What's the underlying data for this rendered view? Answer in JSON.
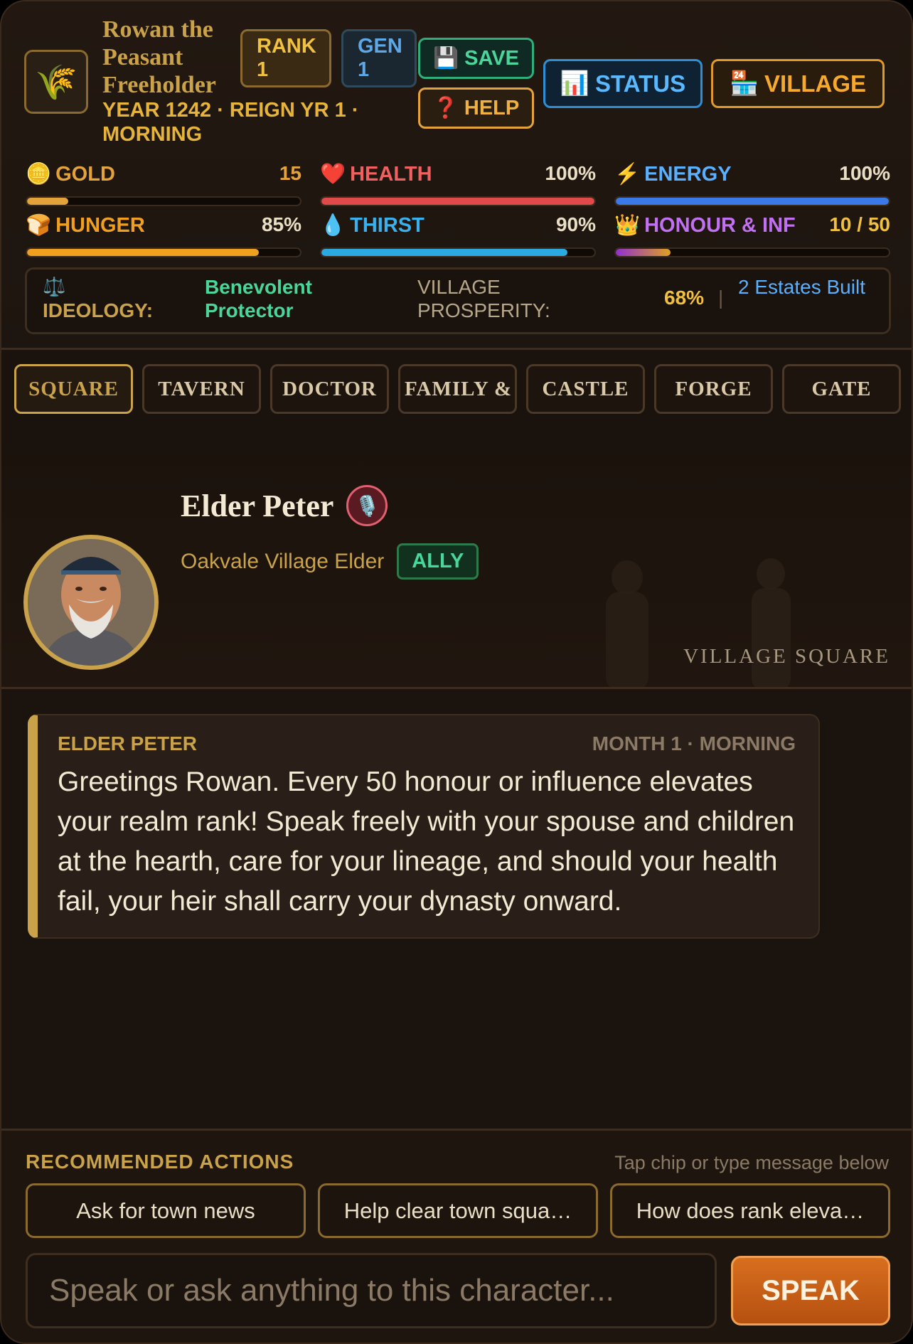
{
  "header": {
    "character_emblem": "wheat-icon",
    "character_name": "Rowan the Peasant Freeholder",
    "date_line": "YEAR 1242 · REIGN YR 1 · MORNING",
    "rank_label": "RANK",
    "rank_value": "1",
    "gen_label": "GEN",
    "gen_value": "1",
    "save_label": "SAVE",
    "help_label": "HELP",
    "status_label": "STATUS",
    "village_label": "VILLAGE"
  },
  "stats": {
    "gold": {
      "label": "GOLD",
      "value": "15",
      "fill": 0.15,
      "color": "#e3a23a"
    },
    "health": {
      "label": "HEALTH",
      "value": "100%",
      "fill": 1.0,
      "color": "#e04a4a"
    },
    "energy": {
      "label": "ENERGY",
      "value": "100%",
      "fill": 1.0,
      "color": "#3a7ae8"
    },
    "hunger": {
      "label": "HUNGER",
      "value": "85%",
      "fill": 0.85,
      "color": "#f0a020"
    },
    "thirst": {
      "label": "THIRST",
      "value": "90%",
      "fill": 0.9,
      "color": "#2aaae0"
    },
    "honour": {
      "label": "HONOUR & INF",
      "value": "10 / 50",
      "fill": 0.2,
      "color": "#b040e0"
    }
  },
  "ideology": {
    "label": "IDEOLOGY:",
    "value": "Benevolent Protector",
    "prosperity_label": "VILLAGE PROSPERITY:",
    "prosperity_value": "68%",
    "separator": "|",
    "estates": "2 Estates Built"
  },
  "tabs": [
    "SQUARE",
    "TAVERN",
    "DOCTOR",
    "FAMILY &",
    "CASTLE",
    "FORGE",
    "GATE"
  ],
  "npc": {
    "name": "Elder Peter",
    "title": "Oakvale Village Elder",
    "relation": "ALLY",
    "location": "VILLAGE SQUARE"
  },
  "message": {
    "speaker": "ELDER PETER",
    "time": "MONTH 1 · MORNING",
    "text": "Greetings Rowan. Every 50 honour or influence elevates your realm rank! Speak freely with your spouse and children at the hearth, care for your lineage, and should your health fail, your heir shall carry your dynasty onward."
  },
  "actions": {
    "title": "RECOMMENDED ACTIONS",
    "hint": "Tap chip or type message below",
    "chips": [
      "Ask for town news",
      "Help clear town squa…",
      "How does rank eleva…"
    ],
    "input_placeholder": "Speak or ask anything to this character...",
    "speak_label": "SPEAK"
  }
}
